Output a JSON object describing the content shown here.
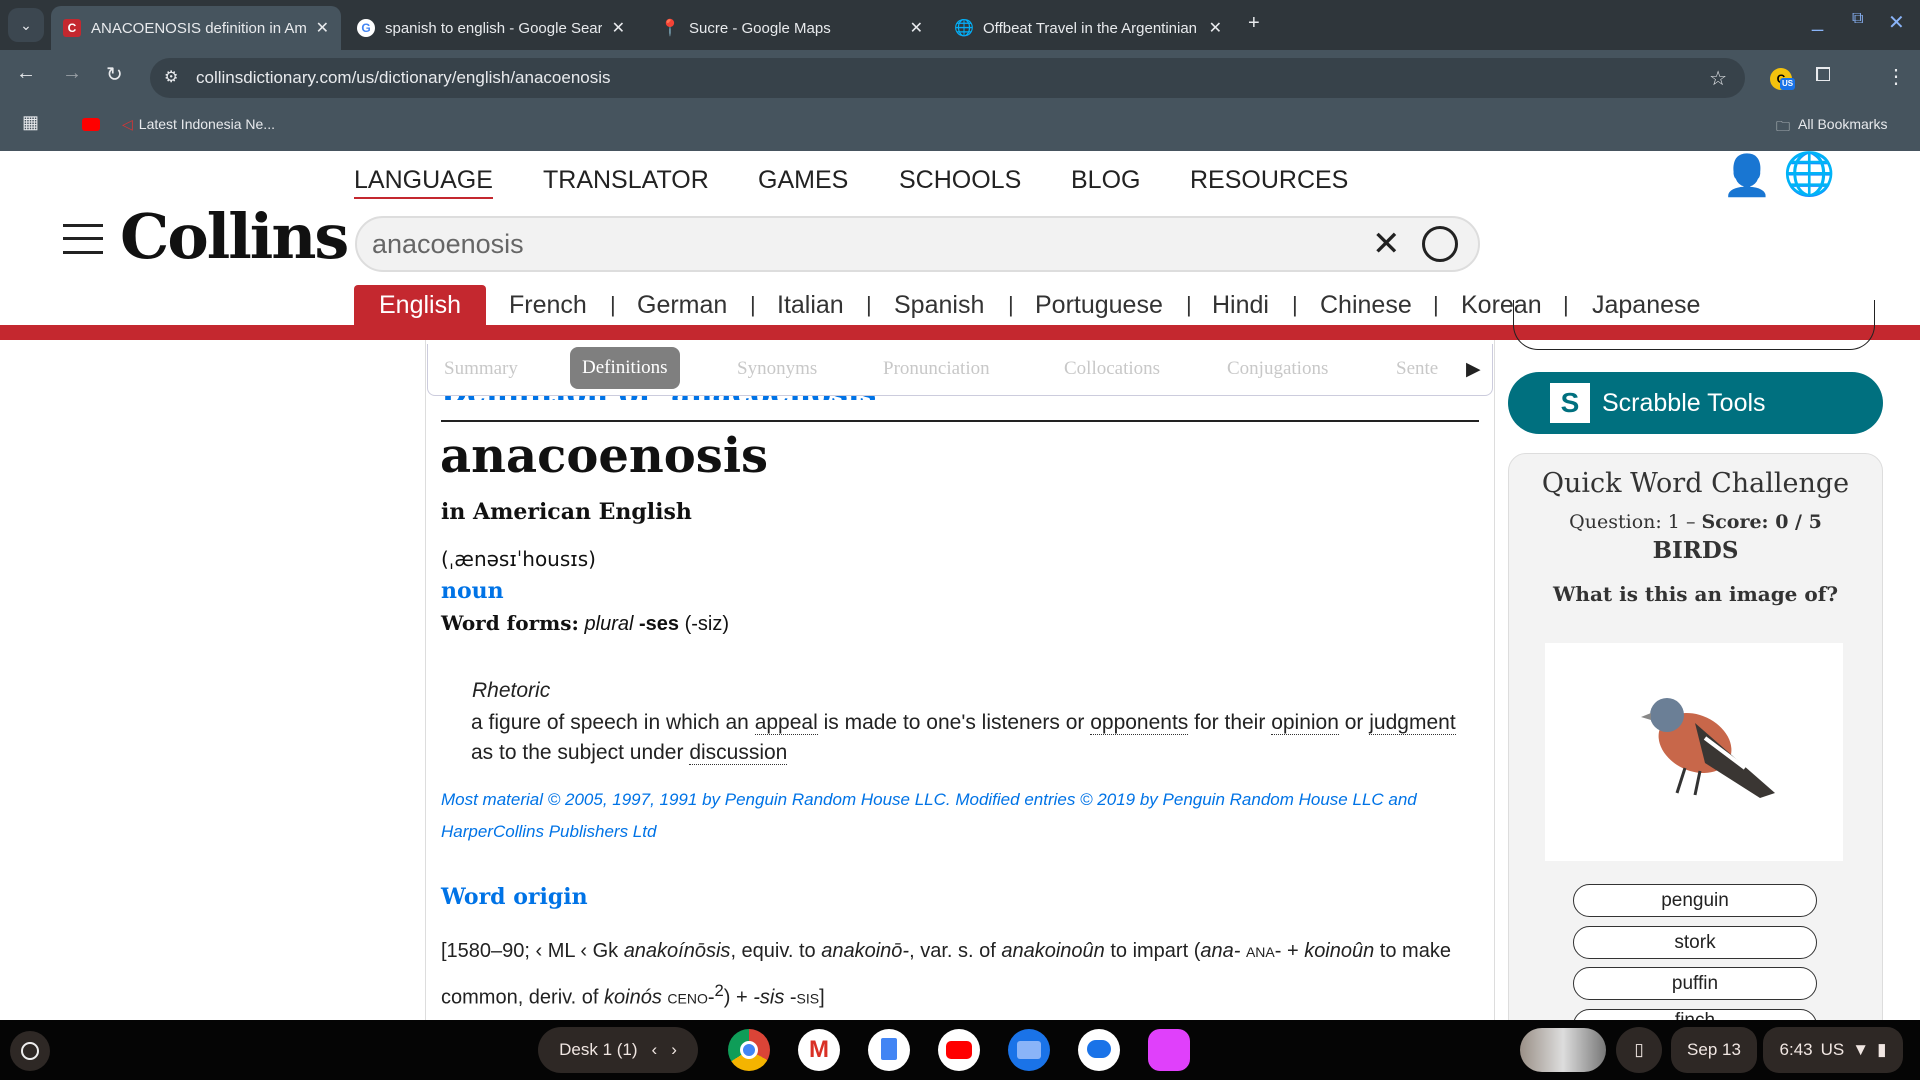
{
  "browser": {
    "tabs": [
      {
        "title": "ANACOENOSIS definition in American English",
        "icon": "collins-favicon",
        "active": true
      },
      {
        "title": "spanish to english - Google Search",
        "icon": "google-favicon"
      },
      {
        "title": "Sucre - Google Maps",
        "icon": "maps-favicon"
      },
      {
        "title": "Offbeat Travel in the Argentinian",
        "icon": "globe-favicon"
      }
    ],
    "url": "collinsdictionary.com/us/dictionary/english/anacoenosis",
    "bookmark": "Latest Indonesia Ne...",
    "all_bookmarks": "All Bookmarks",
    "extension_badge": "US"
  },
  "site": {
    "logo": "Collins",
    "nav": [
      "LANGUAGE",
      "TRANSLATOR",
      "GAMES",
      "SCHOOLS",
      "BLOG",
      "RESOURCES"
    ],
    "search_value": "anacoenosis",
    "languages": [
      "English",
      "French",
      "German",
      "Italian",
      "Spanish",
      "Portuguese",
      "Hindi",
      "Chinese",
      "Korean",
      "Japanese"
    ],
    "accent": "#c4282f"
  },
  "subtabs": [
    "Summary",
    "Definitions",
    "Synonyms",
    "Pronunciation",
    "Collocations",
    "Conjugations",
    "Sente"
  ],
  "entry": {
    "hidden_heading": "Definition of 'anacoenosis'",
    "headword": "anacoenosis",
    "variety": "in American English",
    "pronunciation": "(ˌænəsɪˈhousɪs)",
    "pos": "noun",
    "word_forms_label": "Word forms:",
    "word_forms_plural": "plural",
    "word_forms_suffix": "-ses",
    "word_forms_pron": "(-siz)",
    "domain": "Rhetoric",
    "def_parts": [
      "a figure of speech in which an ",
      "appeal",
      " is made to one's listeners or ",
      "opponents",
      " for their ",
      "opinion",
      " or ",
      "judgment",
      " as to the subject under ",
      "discussion"
    ],
    "copyright": "Most material © 2005, 1997, 1991 by Penguin Random House LLC. Modified entries © 2019 by Penguin Random House LLC and HarperCollins Publishers Ltd",
    "origin_heading": "Word origin",
    "origin": [
      "[1580–90; ‹ ML ‹ Gk ",
      "anakoínōsis",
      ", equiv. to ",
      "anakoinō-",
      ", var. s. of ",
      "anakoinoûn",
      " to impart (",
      "ana-",
      " ana- + ",
      "koinoûn",
      " to make common, deriv. of ",
      "koinós",
      " ceno-",
      "2",
      ") + ",
      "-sis",
      " -sis]"
    ]
  },
  "sidebar": {
    "scrabble": "Scrabble Tools",
    "quiz_title": "Quick Word Challenge",
    "question": "Question: 1",
    "score": "Score: 0 / 5",
    "category": "BIRDS",
    "prompt": "What is this an image of?",
    "options": [
      "penguin",
      "stork",
      "puffin",
      "finch"
    ]
  },
  "taskbar": {
    "desk": "Desk 1 (1)",
    "date": "Sep 13",
    "time": "6:43",
    "locale": "US"
  }
}
